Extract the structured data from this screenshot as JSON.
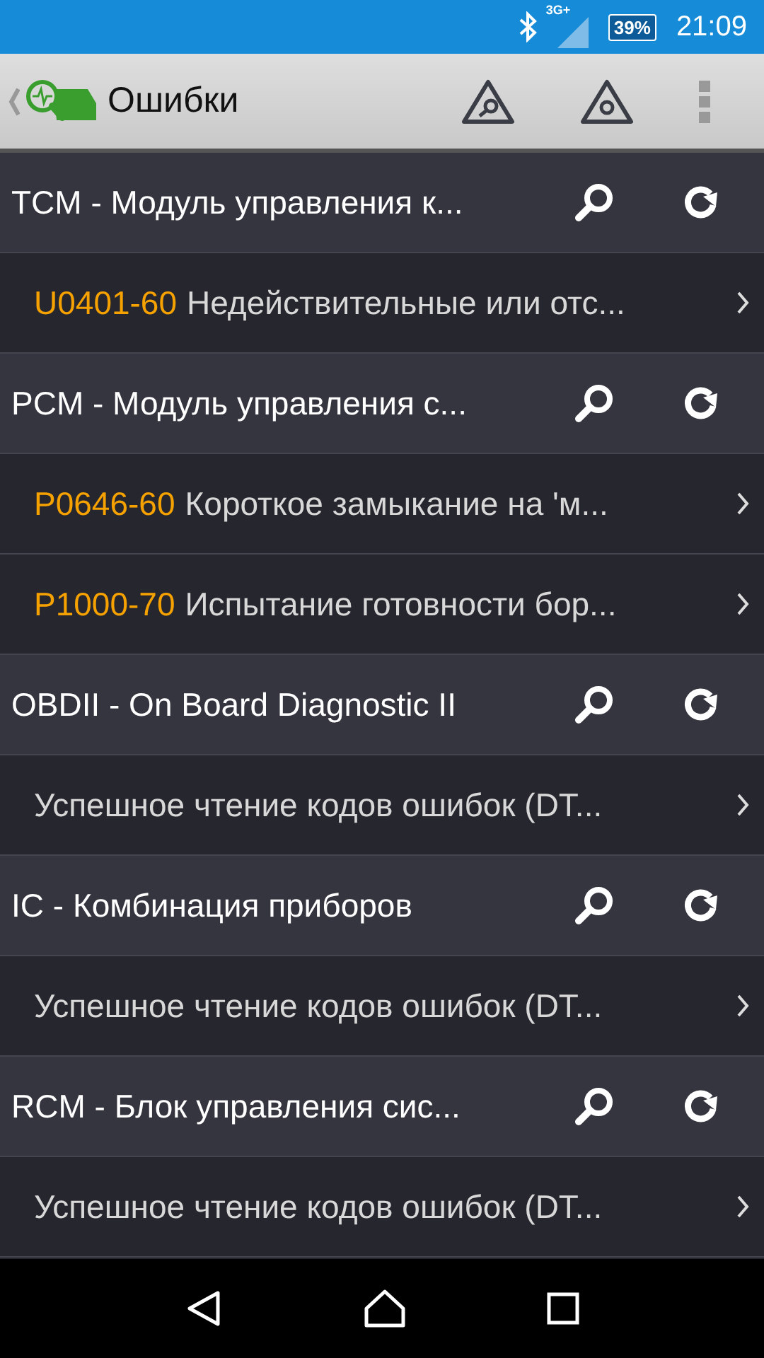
{
  "status_bar": {
    "network": "3G+",
    "battery": "39%",
    "time": "21:09"
  },
  "toolbar": {
    "title": "Ошибки"
  },
  "items": [
    {
      "kind": "module",
      "text": "TCM - Модуль управления к..."
    },
    {
      "kind": "fault",
      "code": "U0401-60",
      "text": "Недействительные или отс..."
    },
    {
      "kind": "module",
      "text": "PCM - Модуль управления с..."
    },
    {
      "kind": "fault",
      "code": "P0646-60",
      "text": "Короткое замыкание на 'м..."
    },
    {
      "kind": "fault",
      "code": "P1000-70",
      "text": "Испытание готовности бор..."
    },
    {
      "kind": "module",
      "text": "OBDII - On Board Diagnostic II"
    },
    {
      "kind": "fault",
      "text": "Успешное чтение кодов ошибок (DT..."
    },
    {
      "kind": "module",
      "text": "IC - Комбинация приборов"
    },
    {
      "kind": "fault",
      "text": "Успешное чтение кодов ошибок (DT..."
    },
    {
      "kind": "module",
      "text": "RCM - Блок управления сис..."
    },
    {
      "kind": "fault",
      "text": "Успешное чтение кодов ошибок (DT..."
    }
  ]
}
